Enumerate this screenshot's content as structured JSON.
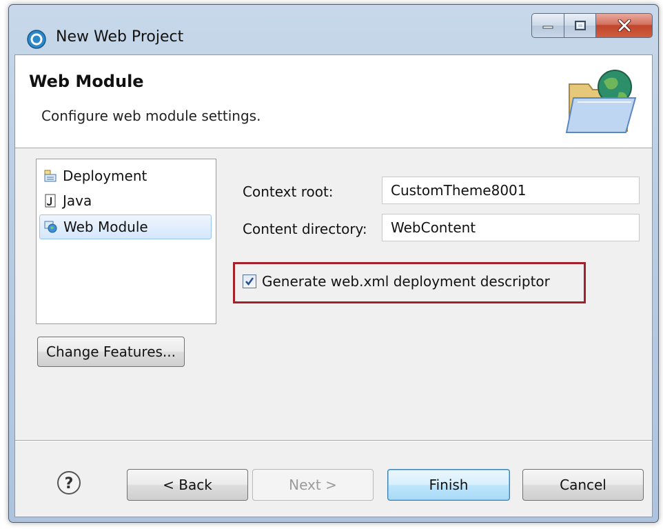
{
  "window": {
    "title": "New Web Project"
  },
  "header": {
    "title": "Web Module",
    "description": "Configure web module settings."
  },
  "tree": {
    "items": [
      {
        "label": "Deployment",
        "icon": "deployment-icon"
      },
      {
        "label": "Java",
        "icon": "java-file-icon"
      },
      {
        "label": "Web Module",
        "icon": "web-module-icon",
        "selected": true
      }
    ]
  },
  "buttons": {
    "change_features": "Change Features...",
    "back": "< Back",
    "next": "Next >",
    "finish": "Finish",
    "cancel": "Cancel"
  },
  "form": {
    "context_root_label": "Context root:",
    "context_root_value": "CustomTheme8001",
    "content_dir_label": "Content directory:",
    "content_dir_value": "WebContent",
    "generate_label": "Generate web.xml deployment descriptor",
    "generate_checked": true
  },
  "colors": {
    "highlight_border": "#a4202a",
    "default_button": "#a7d9f5"
  }
}
